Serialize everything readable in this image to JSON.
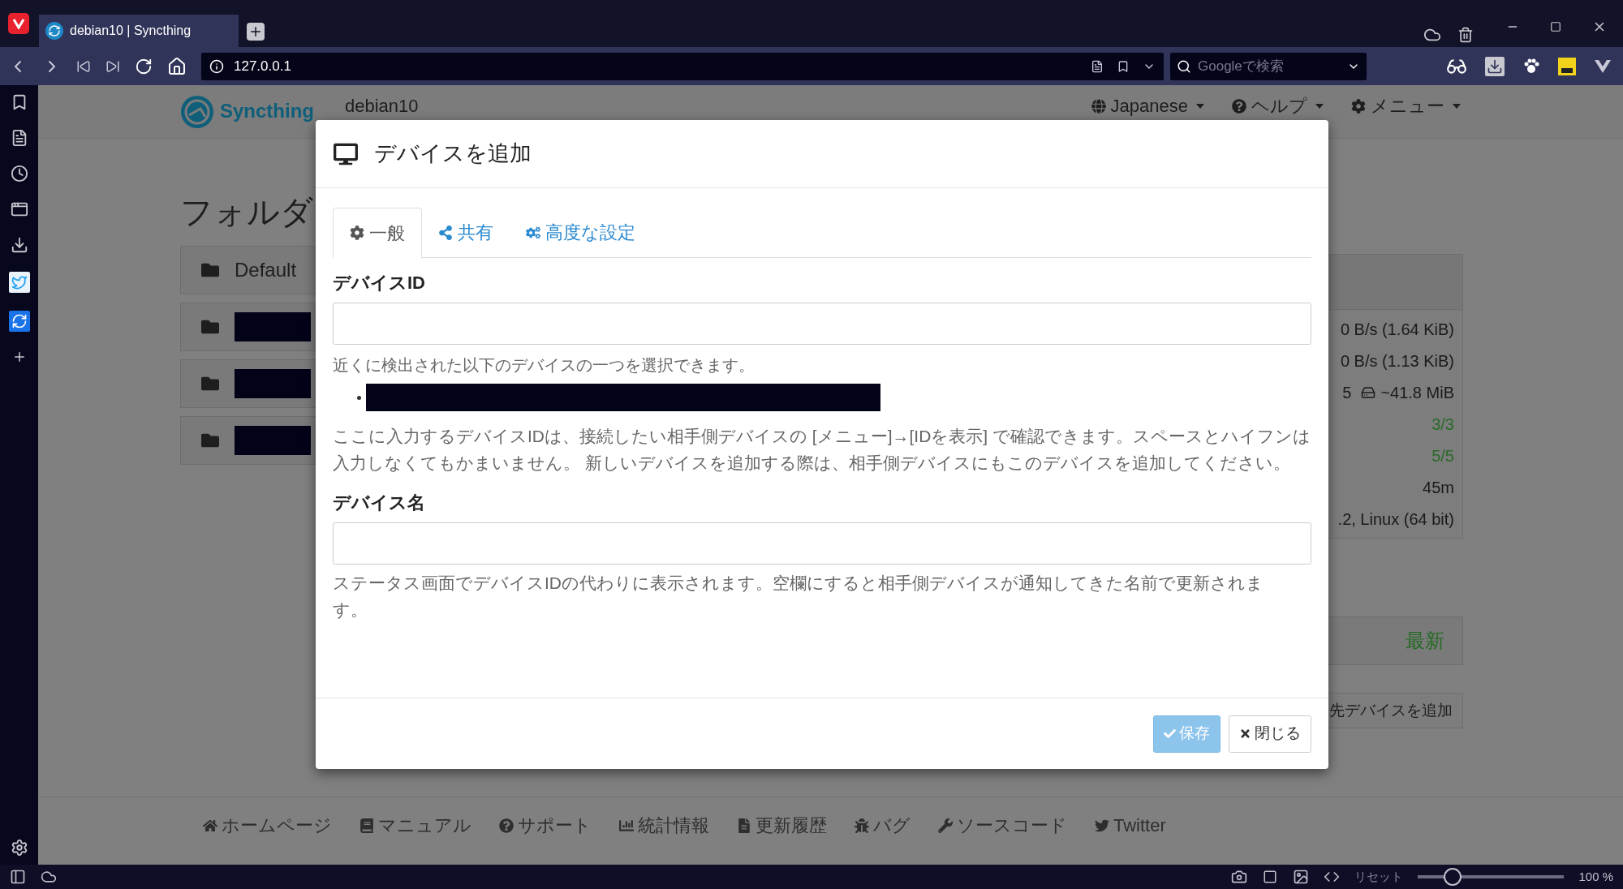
{
  "browser": {
    "tab_title": "debian10 | Syncthing",
    "url": "127.0.0.1",
    "search_placeholder": "Googleで検索"
  },
  "navbar": {
    "brand": "Syncthing",
    "device_name": "debian10",
    "items": [
      {
        "label": "Japanese",
        "kind": "globe"
      },
      {
        "label": "ヘルプ",
        "kind": "question"
      },
      {
        "label": "メニュー",
        "kind": "gear"
      }
    ]
  },
  "folders": {
    "heading": "フォルダ",
    "items": [
      {
        "kind": "named",
        "name": "Default"
      },
      {
        "kind": "redacted"
      },
      {
        "kind": "redacted"
      },
      {
        "kind": "redacted"
      }
    ]
  },
  "device_panel": {
    "rows": [
      {
        "value": "0 B/s (1.64 KiB)",
        "color": "#1a1a1a"
      },
      {
        "value": "0 B/s (1.13 KiB)",
        "color": "#1a1a1a"
      },
      {
        "value": "5",
        "extra": "~41.8 MiB",
        "color": "#1a1a1a"
      },
      {
        "value": "3/3",
        "color": "#2a6a2a"
      },
      {
        "value": "5/5",
        "color": "#2a6a2a"
      },
      {
        "value": "45m",
        "color": "#1a1a1a"
      },
      {
        "value": ".2, Linux (64 bit)",
        "color": "#1a1a1a"
      }
    ],
    "status": "最新",
    "add_button": "先デバイスを追加"
  },
  "modal": {
    "title": "デバイスを追加",
    "tabs": [
      {
        "label": "一般",
        "kind": "gear",
        "selected": true
      },
      {
        "label": "共有",
        "kind": "share",
        "selected": false
      },
      {
        "label": "高度な設定",
        "kind": "gears",
        "selected": false
      }
    ],
    "device_id": {
      "label": "デバイスID",
      "help": "近くに検出された以下のデバイスの一つを選択できます。",
      "nearby": [
        {
          "kind": "redacted"
        }
      ],
      "note": "ここに入力するデバイスIDは、接続したい相手側デバイスの [メニュー]→[IDを表示] で確認できます。スペースとハイフンは入力しなくてもかまいません。 新しいデバイスを追加する際は、相手側デバイスにもこのデバイスを追加してください。"
    },
    "device_name": {
      "label": "デバイス名",
      "help": "ステータス画面でデバイスIDの代わりに表示されます。空欄にすると相手側デバイスが通知してきた名前で更新されます。"
    },
    "buttons": [
      {
        "kind": "save",
        "label": "保存",
        "disabled": true
      },
      {
        "kind": "close",
        "label": "閉じる",
        "disabled": false
      }
    ]
  },
  "footer": [
    {
      "label": "ホームページ",
      "kind": "home"
    },
    {
      "label": "マニュアル",
      "kind": "book"
    },
    {
      "label": "サポート",
      "kind": "question"
    },
    {
      "label": "統計情報",
      "kind": "chart"
    },
    {
      "label": "更新履歴",
      "kind": "file"
    },
    {
      "label": "バグ",
      "kind": "bug"
    },
    {
      "label": "ソースコード",
      "kind": "wrench"
    },
    {
      "label": "Twitter",
      "kind": "twitter"
    }
  ],
  "status_bar": {
    "reset": "リセット",
    "zoom": {
      "level": 0.2
    },
    "zoom_text": "100 %"
  }
}
